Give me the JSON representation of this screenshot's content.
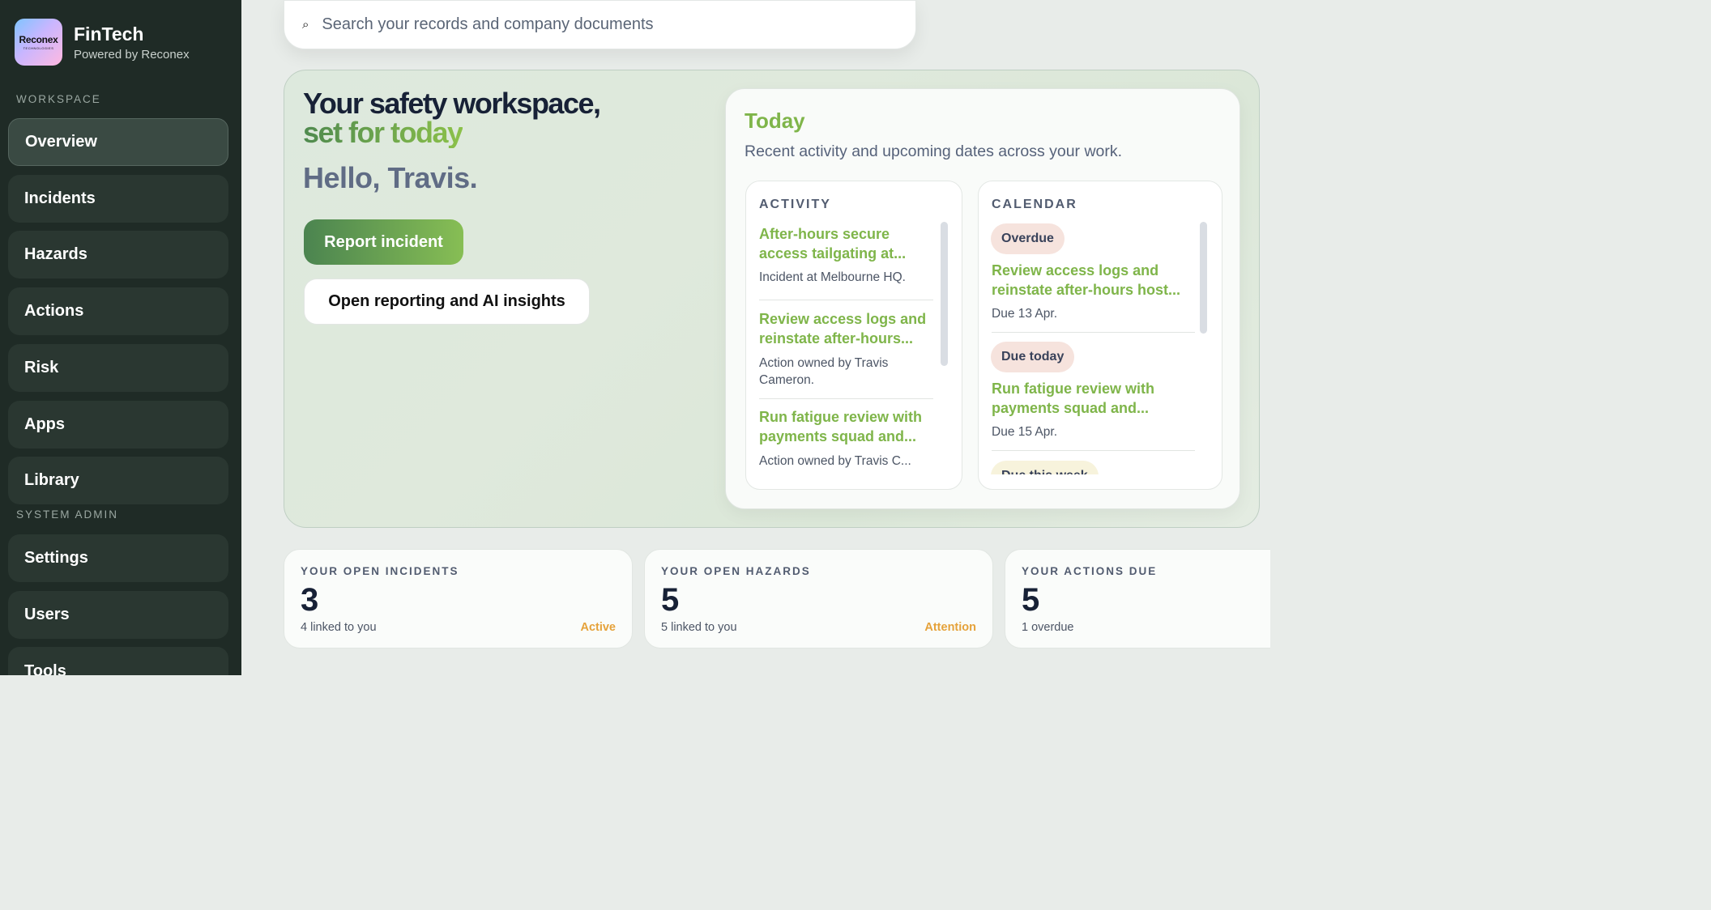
{
  "sidebar": {
    "logo_text": "Reconex",
    "logo_subtext": "TECHNOLOGIES",
    "app_name": "FinTech",
    "powered_by": "Powered by Reconex",
    "workspace_label": "WORKSPACE",
    "workspace_items": [
      {
        "label": "Overview",
        "active": true
      },
      {
        "label": "Incidents"
      },
      {
        "label": "Hazards"
      },
      {
        "label": "Actions"
      },
      {
        "label": "Risk"
      },
      {
        "label": "Apps"
      },
      {
        "label": "Library"
      }
    ],
    "admin_label": "SYSTEM ADMIN",
    "admin_items": [
      {
        "label": "Settings"
      },
      {
        "label": "Users"
      },
      {
        "label": "Tools"
      }
    ]
  },
  "search": {
    "icon": "search-icon",
    "placeholder": "Search your records and company documents"
  },
  "hero": {
    "title_line1": "Your safety workspace,",
    "title_line2": "set for today",
    "greeting": "Hello, Travis.",
    "report_button": "Report incident",
    "insights_button": "Open reporting and AI insights"
  },
  "today": {
    "title": "Today",
    "subtitle": "Recent activity and upcoming dates across your work.",
    "activity": {
      "label": "ACTIVITY",
      "items": [
        {
          "title": "After-hours secure access tailgating at...",
          "sub": "Incident at Melbourne HQ."
        },
        {
          "title": "Review access logs and reinstate after-hours...",
          "sub": "Action owned by Travis Cameron."
        },
        {
          "title": "Run fatigue review with payments squad and...",
          "sub": "Action owned by Travis C..."
        }
      ]
    },
    "calendar": {
      "label": "CALENDAR",
      "items": [
        {
          "badge": "Overdue",
          "badge_color": "#f6e3dd",
          "title": "Review access logs and reinstate after-hours host...",
          "sub": "Due 13 Apr."
        },
        {
          "badge": "Due today",
          "badge_color": "#f6e3dd",
          "title": "Run fatigue review with payments squad and...",
          "sub": "Due 15 Apr."
        },
        {
          "badge": "Due this week",
          "badge_color": "#f7f3dc"
        }
      ]
    }
  },
  "stats": [
    {
      "label": "YOUR OPEN INCIDENTS",
      "value": "3",
      "sub": "4 linked to you",
      "badge": "Active"
    },
    {
      "label": "YOUR OPEN HAZARDS",
      "value": "5",
      "sub": "5 linked to you",
      "badge": "Attention"
    },
    {
      "label": "YOUR ACTIONS DUE",
      "value": "5",
      "sub": "1 overdue",
      "badge": ""
    }
  ],
  "colors": {
    "sidebar_bg": "#1f2b26",
    "accent_green": "#7fb54a",
    "badge_orange": "#e5a23a"
  }
}
